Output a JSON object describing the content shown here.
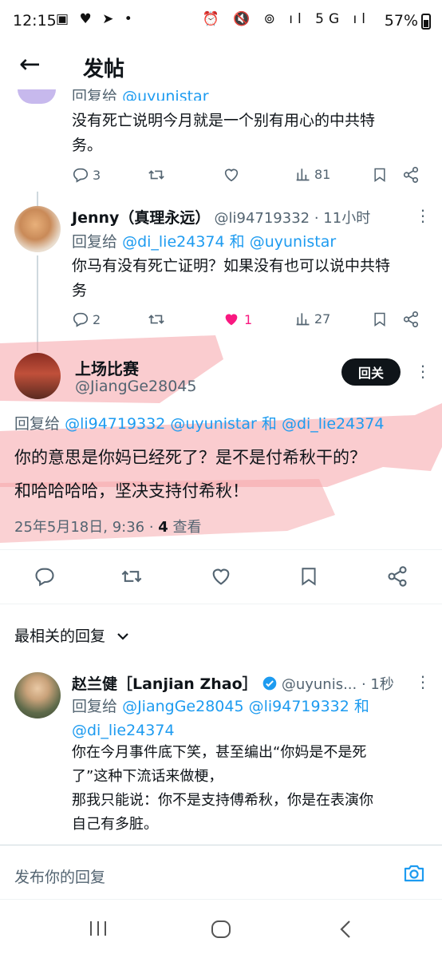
{
  "status_bar": {
    "time": "12:15",
    "left_icons": "▣ ♥ ➤ •",
    "right_icons": "⏰ 🔇 ⊚ ıl 5G ıl",
    "battery": "57%"
  },
  "header": {
    "title": "发帖"
  },
  "tweet1": {
    "reply_prefix": "回复给",
    "reply_handle": "@uyunistar",
    "text_line1": "没有死亡说明今月就是一个别有用心的中共特",
    "text_line2": "务。",
    "replies": "3",
    "likes": "",
    "views": "81"
  },
  "tweet2": {
    "name": "Jenny（真理永远）",
    "handle_time": "@li94719332 · 11小时",
    "reply_prefix": "回复给",
    "reply_handle1": "@di_lie24374",
    "reply_and": "和",
    "reply_handle2": "@uyunistar",
    "text_line1": "你马有没有死亡证明？如果没有也可以说中共特",
    "text_line2": "务",
    "replies": "2",
    "likes": "1",
    "views": "27"
  },
  "main_tweet": {
    "name": "上场比赛",
    "handle": "@JiangGe28045",
    "follow_label": "回关",
    "reply_prefix": "回复给",
    "reply_handle1": "@li94719332",
    "reply_handle2": "@uyunistar",
    "reply_and": "和",
    "reply_handle3": "@di_lie24374",
    "text_line1": "你的意思是你妈已经死了？是不是付希秋干的？",
    "text_line2": "和哈哈哈哈，坚决支持付希秋！",
    "date": "25年5月18日, 9:36 · ",
    "views_count": "4",
    "views_label": " 查看"
  },
  "section": {
    "sort_label": "最相关的回复"
  },
  "reply": {
    "name": "赵兰健［Lanjian Zhao］",
    "handle_time": "@uyunis... · 1秒",
    "reply_prefix": "回复给",
    "reply_handle1": "@JiangGe28045",
    "reply_handle2": "@li94719332",
    "reply_and": "和",
    "reply_handle3": "@di_lie24374",
    "text_line1": "你在今月事件底下笑，甚至编出“你妈是不是死",
    "text_line2": "了”这种下流话来做梗，",
    "text_line3": "那我只能说：你不是支持傅希秋，你是在表演你",
    "text_line4": "自己有多脏。"
  },
  "composer": {
    "placeholder": "发布你的回复"
  },
  "colors": {
    "accent": "#1d9bf0",
    "like": "#f91880",
    "highlight": "#f6a3a7"
  }
}
